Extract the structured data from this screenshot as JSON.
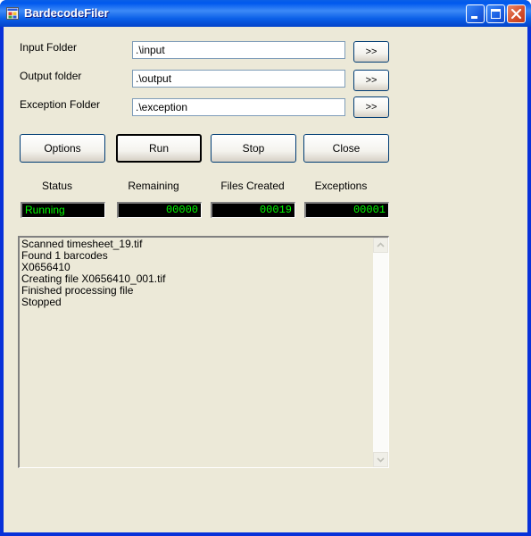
{
  "window": {
    "title": "BardecodeFiler"
  },
  "folders": {
    "input_label": "Input Folder",
    "input_value": ".\\input",
    "output_label": "Output folder",
    "output_value": ".\\output",
    "exception_label": "Exception Folder",
    "exception_value": ".\\exception",
    "browse_label": ">>"
  },
  "actions": {
    "options": "Options",
    "run": "Run",
    "stop": "Stop",
    "close": "Close"
  },
  "stats": {
    "status_label": "Status",
    "status_value": "Running",
    "remaining_label": "Remaining",
    "remaining_value": "00000",
    "files_created_label": "Files Created",
    "files_created_value": "00019",
    "exceptions_label": "Exceptions",
    "exceptions_value": "00001"
  },
  "log": {
    "lines": [
      "Scanned timesheet_19.tif",
      "Found 1 barcodes",
      "X0656410",
      "Creating file X0656410_001.tif",
      "Finished processing file",
      "Stopped"
    ]
  },
  "icons": {
    "app": "app-window-icon",
    "minimize": "minimize-icon",
    "maximize": "maximize-icon",
    "close": "close-icon",
    "scroll_up": "scroll-up-arrow-icon",
    "scroll_down": "scroll-down-arrow-icon"
  },
  "colors": {
    "counter_text": "#00ff00",
    "counter_bg": "#000000",
    "titlebar": "#0a5fe7",
    "close_button": "#d5522d",
    "dialog_bg": "#ece9d8"
  }
}
